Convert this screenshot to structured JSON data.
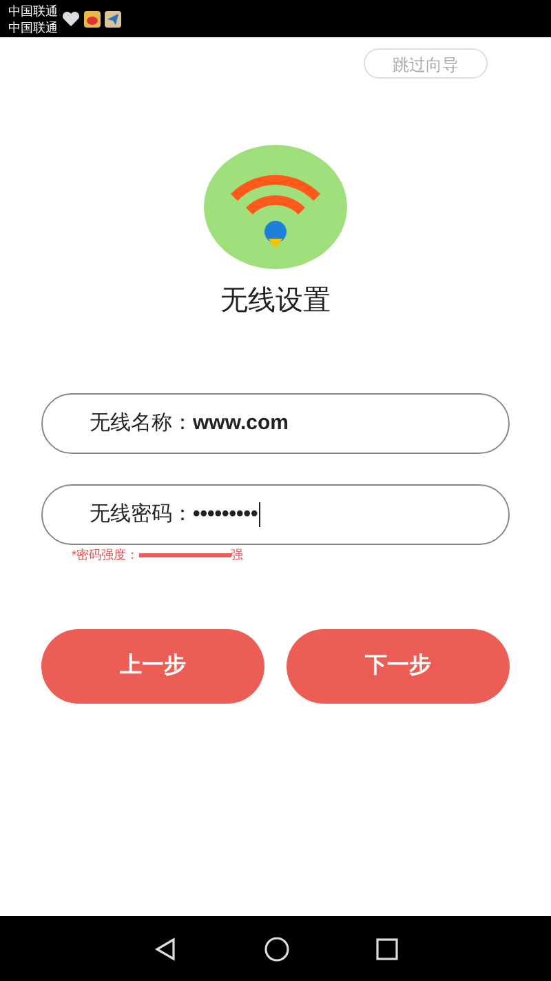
{
  "status_bar": {
    "carriers": [
      "中国联通",
      "中国联通"
    ]
  },
  "skip_button": "跳过向导",
  "title": "无线设置",
  "fields": [
    {
      "label": "无线名称：",
      "value": "www.com",
      "kind": "text"
    },
    {
      "label": "无线密码：",
      "value": "•••••••••",
      "kind": "password"
    }
  ],
  "strength": {
    "label": "*密码强度：",
    "level": 1,
    "reading": "强"
  },
  "buttons": [
    "上一步",
    "下一步"
  ]
}
